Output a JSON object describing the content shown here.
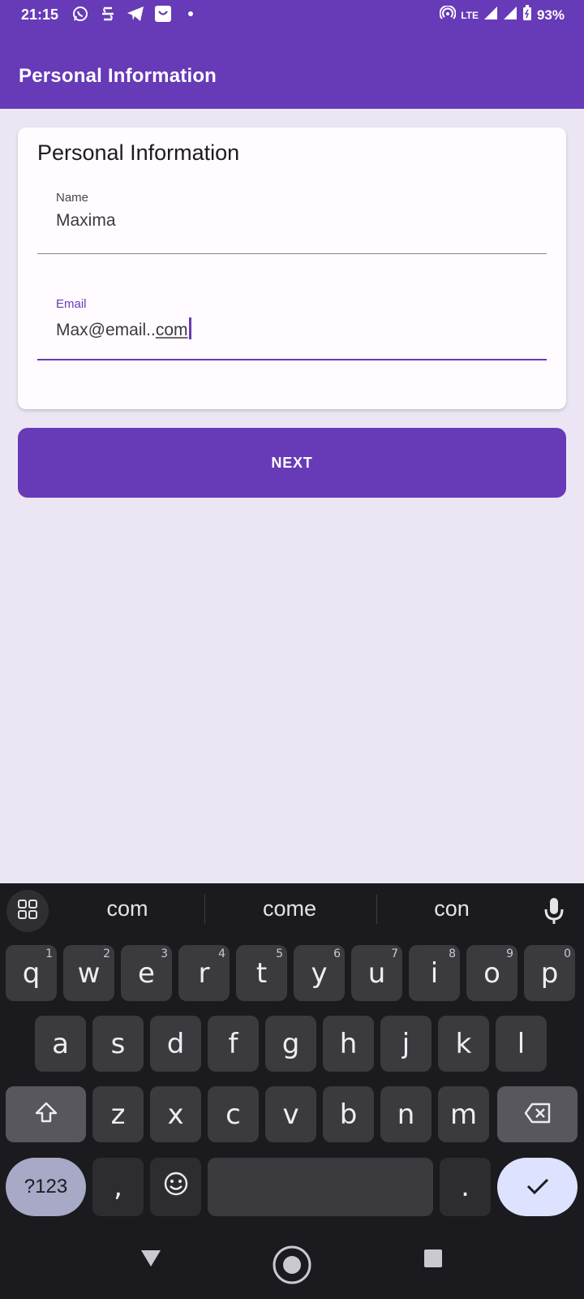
{
  "status_bar": {
    "time": "21:15",
    "network": "LTE",
    "battery": "93%",
    "left_icons": [
      "whatsapp-icon",
      "app-icon",
      "telegram-icon",
      "shop-icon",
      "dot-icon"
    ]
  },
  "app_bar": {
    "title": "Personal Information"
  },
  "card": {
    "title": "Personal Information",
    "name_field": {
      "label": "Name",
      "value": "Maxima"
    },
    "email_field": {
      "label": "Email",
      "value_prefix": "Max@email..",
      "value_underlined": "com"
    }
  },
  "next_button": {
    "label": "NEXT"
  },
  "keyboard": {
    "suggestions": [
      "com",
      "come",
      "con"
    ],
    "row1": [
      {
        "k": "q",
        "h": "1"
      },
      {
        "k": "w",
        "h": "2"
      },
      {
        "k": "e",
        "h": "3"
      },
      {
        "k": "r",
        "h": "4"
      },
      {
        "k": "t",
        "h": "5"
      },
      {
        "k": "y",
        "h": "6"
      },
      {
        "k": "u",
        "h": "7"
      },
      {
        "k": "i",
        "h": "8"
      },
      {
        "k": "o",
        "h": "9"
      },
      {
        "k": "p",
        "h": "0"
      }
    ],
    "row2": [
      "a",
      "s",
      "d",
      "f",
      "g",
      "h",
      "j",
      "k",
      "l"
    ],
    "row3": [
      "z",
      "x",
      "c",
      "v",
      "b",
      "n",
      "m"
    ],
    "symbols_label": "?123",
    "comma": ",",
    "period": "."
  },
  "colors": {
    "primary": "#673AB7",
    "background": "#ECE6F4",
    "card": "#FFFBFF",
    "keyboard_bg": "#1B1B1F"
  }
}
